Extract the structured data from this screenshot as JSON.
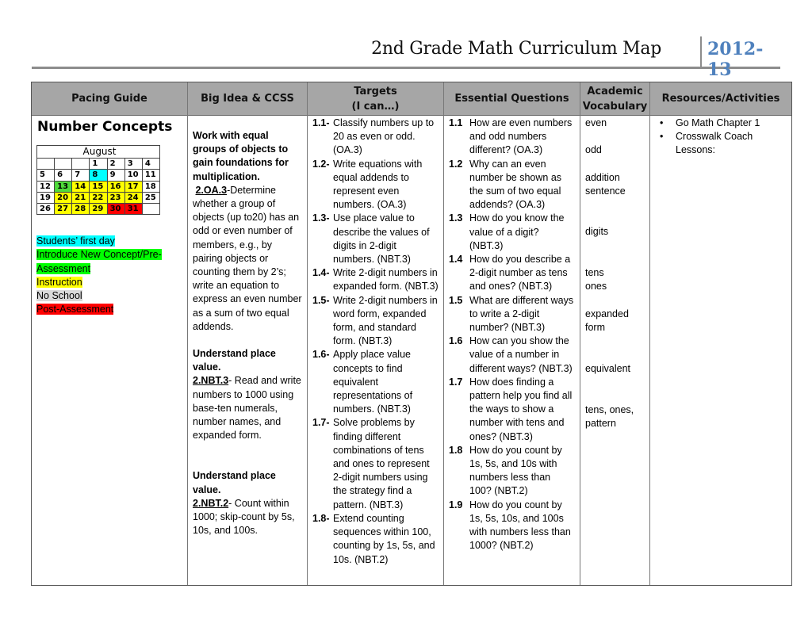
{
  "header": {
    "title": "2nd Grade Math Curriculum Map",
    "year": "2012-13",
    "year_color": "#4f81bd"
  },
  "table": {
    "columns": [
      {
        "label": "Pacing Guide"
      },
      {
        "label": "Big Idea & CCSS"
      },
      {
        "label_line1": "Targets",
        "label_line2": "(I can…)"
      },
      {
        "label": "Essential Questions"
      },
      {
        "label_line1": "Academic",
        "label_line2": "Vocabulary"
      },
      {
        "label": "Resources/Activities"
      }
    ],
    "header_bg": "#a6a6a6"
  },
  "pacing": {
    "unit_title": "Number Concepts",
    "calendar": {
      "month": "August",
      "weeks": [
        [
          {
            "d": ""
          },
          {
            "d": ""
          },
          {
            "d": ""
          },
          {
            "d": "1"
          },
          {
            "d": "2"
          },
          {
            "d": "3"
          },
          {
            "d": "4"
          }
        ],
        [
          {
            "d": "5"
          },
          {
            "d": "6"
          },
          {
            "d": "7"
          },
          {
            "d": "8",
            "status": "first-day"
          },
          {
            "d": "9"
          },
          {
            "d": "10"
          },
          {
            "d": "11"
          }
        ],
        [
          {
            "d": "12"
          },
          {
            "d": "13",
            "status": "introduce"
          },
          {
            "d": "14",
            "status": "instruction"
          },
          {
            "d": "15",
            "status": "instruction"
          },
          {
            "d": "16",
            "status": "instruction"
          },
          {
            "d": "17",
            "status": "instruction"
          },
          {
            "d": "18"
          }
        ],
        [
          {
            "d": "19"
          },
          {
            "d": "20",
            "status": "instruction"
          },
          {
            "d": "21",
            "status": "instruction"
          },
          {
            "d": "22",
            "status": "instruction"
          },
          {
            "d": "23",
            "status": "instruction"
          },
          {
            "d": "24",
            "status": "instruction"
          },
          {
            "d": "25"
          }
        ],
        [
          {
            "d": "26"
          },
          {
            "d": "27",
            "status": "instruction"
          },
          {
            "d": "28",
            "status": "instruction"
          },
          {
            "d": "29",
            "status": "instruction"
          },
          {
            "d": "30",
            "status": "post-assessment"
          },
          {
            "d": "31",
            "status": "post-assessment"
          },
          {
            "d": ""
          }
        ]
      ]
    },
    "legend": [
      {
        "label": "Students’ first day",
        "color": "#00ffff",
        "text_color": "#000000"
      },
      {
        "label_line1": "Introduce New Concept/Pre-",
        "label_line2": "Assessment",
        "color": "#00ff00",
        "text_color": "#000000"
      },
      {
        "label": "Instruction",
        "color": "#ffff00",
        "text_color": "#000000"
      },
      {
        "label": "No School",
        "color": "#d9d9d9",
        "text_color": "#000000"
      },
      {
        "label": "Post-Assessment",
        "color": "#ff0000",
        "text_color": "#000000"
      }
    ]
  },
  "big_idea": [
    {
      "heading": "Work with equal groups of objects to gain foundations for multiplication.",
      "code": "2.OA.3",
      "text": "-Determine whether a group of objects (up to20) has an odd or even number of members, e.g., by pairing objects or counting them by 2’s; write an equation to express an even number as a sum of two equal addends."
    },
    {
      "heading": "Understand place value.",
      "code": "2.NBT.3",
      "text": "- Read and write numbers to 1000 using base-ten numerals, number names, and expanded form."
    },
    {
      "heading": "Understand place value.",
      "code": "2.NBT.2",
      "text": "- Count within 1000; skip-count by 5s, 10s, and 100s."
    }
  ],
  "targets": [
    {
      "num": "1.1-",
      "text": "Classify numbers up to 20 as even or odd. (OA.3)"
    },
    {
      "num": "1.2-",
      "text": "Write equations with equal addends to represent even numbers. (OA.3)"
    },
    {
      "num": "1.3-",
      "text": "Use place value to describe the values of digits in 2-digit numbers.  (NBT.3)"
    },
    {
      "num": "1.4-",
      "text": "Write 2-digit numbers in expanded form. (NBT.3)"
    },
    {
      "num": "1.5-",
      "text": "Write 2-digit numbers in word form, expanded form, and standard form. (NBT.3)"
    },
    {
      "num": "1.6-",
      "text": "Apply place value concepts to find equivalent representations of numbers. (NBT.3)"
    },
    {
      "num": "1.7-",
      "text": "Solve problems by finding different combinations of tens and ones to represent 2-digit numbers using the strategy find a pattern. (NBT.3)"
    },
    {
      "num": "1.8-",
      "text": "Extend counting sequences within 100, counting by 1s, 5s, and 10s. (NBT.2)"
    }
  ],
  "essential_questions": [
    {
      "num": "1.1",
      "text": "How are even numbers and odd numbers different? (OA.3)"
    },
    {
      "num": "1.2",
      "text": "Why can an even number be shown as the sum of two equal addends? (OA.3)"
    },
    {
      "num": "1.3",
      "text": "How do you know the value of a digit? (NBT.3)"
    },
    {
      "num": "1.4",
      "text": "How do you describe a 2-digit number as tens and ones? (NBT.3)"
    },
    {
      "num": "1.5",
      "text": "What are different ways to write a 2-digit number? (NBT.3)"
    },
    {
      "num": "1.6",
      "text": "How can you show the value of a number in different ways? (NBT.3)"
    },
    {
      "num": "1.7",
      "text": "How does finding a pattern help you find all the ways to show a number with tens and ones? (NBT.3)"
    },
    {
      "num": "1.8",
      "text": "How do you count by 1s, 5s, and 10s with numbers less than 100? (NBT.2)"
    },
    {
      "num": "1.9",
      "text": "How do you count by 1s, 5s, 10s, and 100s with numbers less than 1000? (NBT.2)"
    }
  ],
  "vocabulary": [
    {
      "line1": "even"
    },
    {
      "line1": "odd"
    },
    {
      "line1": "addition",
      "line2": "sentence"
    },
    {
      "line1": "digits"
    },
    {
      "line1": "tens",
      "line2": "ones"
    },
    {
      "line1": "expanded",
      "line2": "form"
    },
    {
      "line1": "equivalent"
    },
    {
      "line1": "tens, ones,",
      "line2": "pattern"
    }
  ],
  "resources": [
    {
      "text": "Go Math Chapter 1"
    },
    {
      "text": "Crosswalk Coach Lessons:"
    }
  ]
}
